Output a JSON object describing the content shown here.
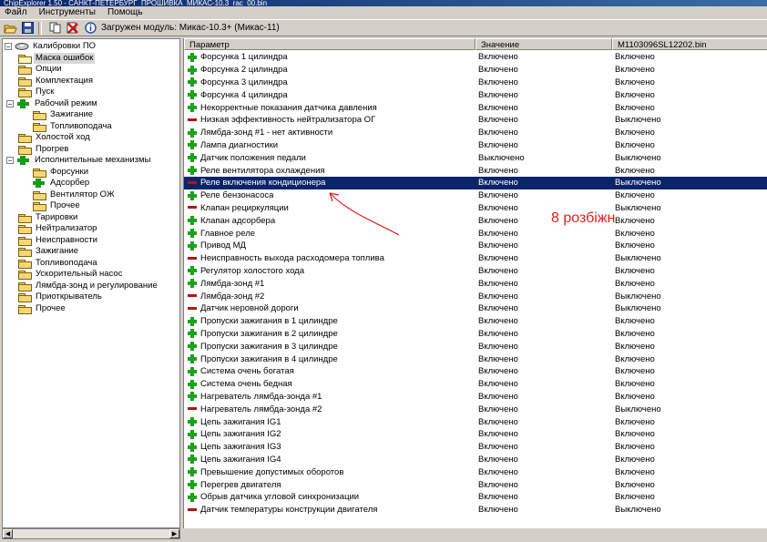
{
  "window": {
    "title": "ChipExplorer 1.50 - САНКТ-ПЕТЕРБУРГ_ПРОШИВКА_МИКАС-10.3_rac_00.bin"
  },
  "menu": [
    "Файл",
    "Инструменты",
    "Помощь"
  ],
  "toolbar": {
    "status": "Загружен модуль: Микас-10.3+ (Микас-11)"
  },
  "tree": {
    "root": "Калибровки ПО",
    "items": [
      {
        "label": "Маска ошибок",
        "level": 1,
        "selected": true,
        "icon": "folder-open"
      },
      {
        "label": "Опции",
        "level": 1,
        "icon": "folder"
      },
      {
        "label": "Комплектация",
        "level": 1,
        "icon": "folder"
      },
      {
        "label": "Пуск",
        "level": 1,
        "icon": "folder"
      },
      {
        "label": "Рабочий режим",
        "level": 1,
        "icon": "folder-plus",
        "expander": "-"
      },
      {
        "label": "Зажигание",
        "level": 2,
        "icon": "folder"
      },
      {
        "label": "Топливоподача",
        "level": 2,
        "icon": "folder"
      },
      {
        "label": "Холостой ход",
        "level": 1,
        "icon": "folder"
      },
      {
        "label": "Прогрев",
        "level": 1,
        "icon": "folder"
      },
      {
        "label": "Исполнительные механизмы",
        "level": 1,
        "icon": "folder-plus",
        "expander": "-"
      },
      {
        "label": "Форсунки",
        "level": 2,
        "icon": "folder"
      },
      {
        "label": "Адсорбер",
        "level": 2,
        "icon": "folder-plus"
      },
      {
        "label": "Вентилятор ОЖ",
        "level": 2,
        "icon": "folder"
      },
      {
        "label": "Прочее",
        "level": 2,
        "icon": "folder"
      },
      {
        "label": "Тарировки",
        "level": 1,
        "icon": "folder"
      },
      {
        "label": "Нейтрализатор",
        "level": 1,
        "icon": "folder"
      },
      {
        "label": "Неисправности",
        "level": 1,
        "icon": "folder"
      },
      {
        "label": "Зажигание",
        "level": 1,
        "icon": "folder"
      },
      {
        "label": "Топливоподача",
        "level": 1,
        "icon": "folder"
      },
      {
        "label": "Ускорительный насос",
        "level": 1,
        "icon": "folder"
      },
      {
        "label": "Лямбда-зонд и регулирование",
        "level": 1,
        "icon": "folder"
      },
      {
        "label": "Приоткрыватель",
        "level": 1,
        "icon": "folder"
      },
      {
        "label": "Прочее",
        "level": 1,
        "icon": "folder"
      }
    ]
  },
  "grid": {
    "columns": [
      "Параметр",
      "Значение",
      "M1103096SL12202.bin"
    ],
    "rows": [
      {
        "name": "Форсунка 1 цилиндра",
        "value": "Включено",
        "file": "Включено",
        "icon": "plus"
      },
      {
        "name": "Форсунка 2 цилиндра",
        "value": "Включено",
        "file": "Включено",
        "icon": "plus"
      },
      {
        "name": "Форсунка 3 цилиндра",
        "value": "Включено",
        "file": "Включено",
        "icon": "plus"
      },
      {
        "name": "Форсунка 4 цилиндра",
        "value": "Включено",
        "file": "Включено",
        "icon": "plus"
      },
      {
        "name": "Некорректные показания датчика давления",
        "value": "Включено",
        "file": "Включено",
        "icon": "plus"
      },
      {
        "name": "Низкая эффективность нейтрализатора ОГ",
        "value": "Включено",
        "file": "Выключено",
        "icon": "minus"
      },
      {
        "name": "Лямбда-зонд #1 - нет активности",
        "value": "Включено",
        "file": "Включено",
        "icon": "plus"
      },
      {
        "name": "Лампа диагностики",
        "value": "Включено",
        "file": "Включено",
        "icon": "plus"
      },
      {
        "name": "Датчик положения педали",
        "value": "Выключено",
        "file": "Выключено",
        "icon": "plus"
      },
      {
        "name": "Реле вентилятора охлаждения",
        "value": "Включено",
        "file": "Включено",
        "icon": "plus"
      },
      {
        "name": "Реле включения кондиционера",
        "value": "Включено",
        "file": "Выключено",
        "icon": "minus",
        "selected": true
      },
      {
        "name": "Реле бензонасоса",
        "value": "Включено",
        "file": "Включено",
        "icon": "plus"
      },
      {
        "name": "Клапан рециркуляции",
        "value": "Включено",
        "file": "Выключено",
        "icon": "minus"
      },
      {
        "name": "Клапан адсорбера",
        "value": "Включено",
        "file": "Включено",
        "icon": "plus"
      },
      {
        "name": "Главное реле",
        "value": "Включено",
        "file": "Включено",
        "icon": "plus"
      },
      {
        "name": "Привод МД",
        "value": "Включено",
        "file": "Включено",
        "icon": "plus"
      },
      {
        "name": "Неисправность выхода расходомера топлива",
        "value": "Включено",
        "file": "Выключено",
        "icon": "minus"
      },
      {
        "name": "Регулятор холостого хода",
        "value": "Включено",
        "file": "Включено",
        "icon": "plus"
      },
      {
        "name": "Лямбда-зонд #1",
        "value": "Включено",
        "file": "Включено",
        "icon": "plus"
      },
      {
        "name": "Лямбда-зонд #2",
        "value": "Включено",
        "file": "Выключено",
        "icon": "minus"
      },
      {
        "name": "Датчик неровной дороги",
        "value": "Включено",
        "file": "Выключено",
        "icon": "minus"
      },
      {
        "name": "Пропуски зажигания в 1 цилиндре",
        "value": "Включено",
        "file": "Включено",
        "icon": "plus"
      },
      {
        "name": "Пропуски зажигания в 2 цилиндре",
        "value": "Включено",
        "file": "Включено",
        "icon": "plus"
      },
      {
        "name": "Пропуски зажигания в 3 цилиндре",
        "value": "Включено",
        "file": "Включено",
        "icon": "plus"
      },
      {
        "name": "Пропуски зажигания в 4 цилиндре",
        "value": "Включено",
        "file": "Включено",
        "icon": "plus"
      },
      {
        "name": "Система очень богатая",
        "value": "Включено",
        "file": "Включено",
        "icon": "plus"
      },
      {
        "name": "Система очень бедная",
        "value": "Включено",
        "file": "Включено",
        "icon": "plus"
      },
      {
        "name": "Нагреватель лямбда-зонда #1",
        "value": "Включено",
        "file": "Включено",
        "icon": "plus"
      },
      {
        "name": "Нагреватель лямбда-зонда #2",
        "value": "Включено",
        "file": "Выключено",
        "icon": "minus"
      },
      {
        "name": "Цепь зажигания IG1",
        "value": "Включено",
        "file": "Включено",
        "icon": "plus"
      },
      {
        "name": "Цепь зажигания IG2",
        "value": "Включено",
        "file": "Включено",
        "icon": "plus"
      },
      {
        "name": "Цепь зажигания IG3",
        "value": "Включено",
        "file": "Включено",
        "icon": "plus"
      },
      {
        "name": "Цепь зажигания IG4",
        "value": "Включено",
        "file": "Включено",
        "icon": "plus"
      },
      {
        "name": "Превышение допустимых оборотов",
        "value": "Включено",
        "file": "Включено",
        "icon": "plus"
      },
      {
        "name": "Перегрев двигателя",
        "value": "Включено",
        "file": "Включено",
        "icon": "plus"
      },
      {
        "name": "Обрыв датчика угловой синхронизации",
        "value": "Включено",
        "file": "Включено",
        "icon": "plus"
      },
      {
        "name": "Датчик температуры конструкции двигателя",
        "value": "Включено",
        "file": "Выключено",
        "icon": "minus"
      }
    ]
  },
  "annotation": {
    "text": "8 розбіжн",
    "color": "#e02020"
  }
}
